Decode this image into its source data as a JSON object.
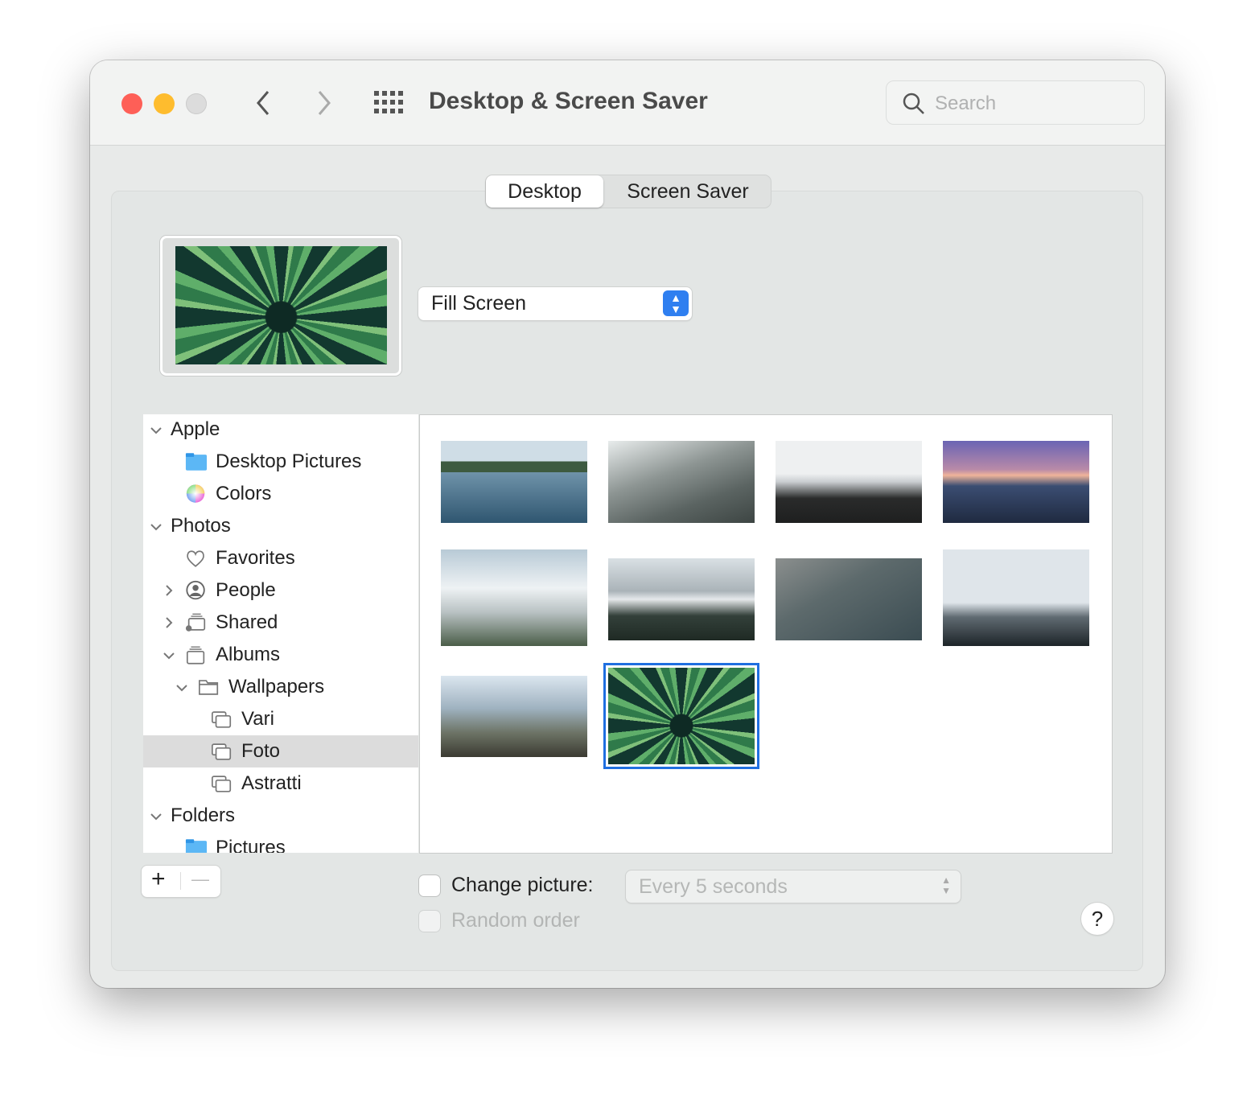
{
  "window": {
    "title": "Desktop & Screen Saver",
    "search_placeholder": "Search"
  },
  "tabs": [
    {
      "label": "Desktop",
      "selected": true
    },
    {
      "label": "Screen Saver",
      "selected": false
    }
  ],
  "fit_popup": {
    "value": "Fill Screen"
  },
  "sidebar": {
    "items": [
      {
        "label": "Apple",
        "kind": "group",
        "expanded": true
      },
      {
        "label": "Desktop Pictures",
        "icon": "folder-icon"
      },
      {
        "label": "Colors",
        "icon": "color-wheel-icon"
      },
      {
        "label": "Photos",
        "kind": "group",
        "expanded": true
      },
      {
        "label": "Favorites",
        "icon": "heart-icon"
      },
      {
        "label": "People",
        "icon": "person-circle-icon",
        "expanded": false
      },
      {
        "label": "Shared",
        "icon": "shared-album-icon",
        "expanded": false
      },
      {
        "label": "Albums",
        "icon": "albums-icon",
        "expanded": true
      },
      {
        "label": "Wallpapers",
        "icon": "folder-outline-icon",
        "expanded": true
      },
      {
        "label": "Vari",
        "icon": "album-icon"
      },
      {
        "label": "Foto",
        "icon": "album-icon",
        "selected": true
      },
      {
        "label": "Astratti",
        "icon": "album-icon"
      },
      {
        "label": "Folders",
        "kind": "group",
        "expanded": true
      },
      {
        "label": "Pictures",
        "icon": "pictures-folder-icon"
      }
    ]
  },
  "bottom": {
    "add": "+",
    "remove": "—",
    "change_picture_label": "Change picture:",
    "change_picture_checked": false,
    "interval": "Every 5 seconds",
    "random_order_label": "Random order",
    "random_order_checked": false,
    "help": "?"
  },
  "colors": {
    "accent": "#1f6fe0",
    "close": "#fe5f57",
    "minimize": "#febc2e"
  }
}
